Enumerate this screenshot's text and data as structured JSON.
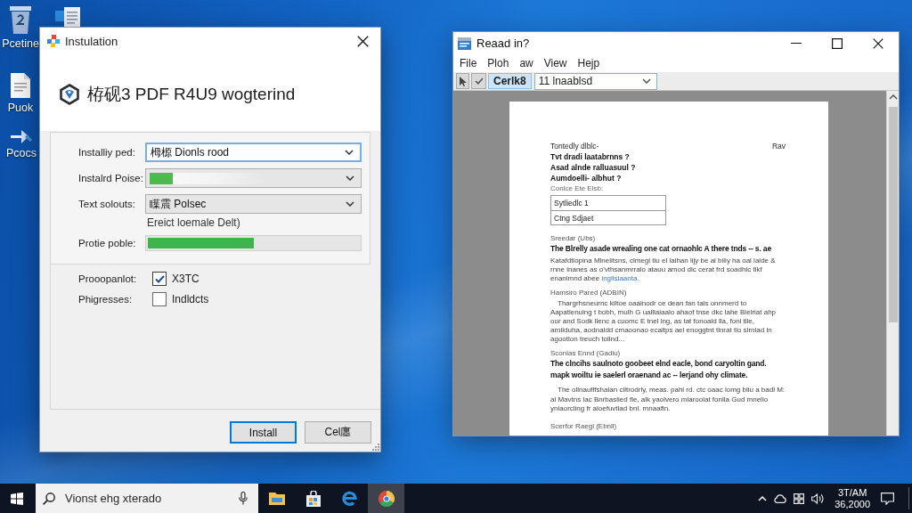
{
  "desktop_icons": [
    {
      "label": "Pcetine"
    },
    {
      "label": "Puok"
    },
    {
      "label": "Pcocs"
    }
  ],
  "installer": {
    "title": "Instulation",
    "heading": "栫砚3 PDF R4U9 wogterind",
    "fields": [
      {
        "kind": "select",
        "label": "Installiy ped:",
        "value": "栂榞 Dionls rood",
        "focused": true
      },
      {
        "kind": "bar",
        "label": "Instalrd Poise:",
        "level": 0.12,
        "focused": false
      },
      {
        "kind": "select",
        "label": "Text solouts:",
        "value": "瞸震 Polsec",
        "focused": false,
        "note": "Ereict loemale Delt)"
      },
      {
        "kind": "progress",
        "label": "Protie poble:",
        "level": 0.5
      }
    ],
    "options": [
      {
        "label": "Prooopanlot:",
        "text": "X3TC",
        "checked": true
      },
      {
        "label": "Phigresses:",
        "text": "Indldcts",
        "checked": false
      }
    ],
    "buttons": [
      {
        "label": "Install",
        "default": true
      },
      {
        "label": "Cel廛",
        "default": false
      }
    ]
  },
  "reader": {
    "title": "Reaad in?",
    "menu": [
      "File",
      "Ploh",
      "aw",
      "View",
      "Hejp"
    ],
    "toolbar": {
      "button": {
        "label": "Cerlk8",
        "selected": true
      },
      "field": {
        "value": "11 lnaablsd"
      }
    },
    "document": {
      "header": {
        "left": "Tontedly dlblc-",
        "right": "Rav"
      },
      "blocks": [
        {
          "kind": "question",
          "text": "Tvt dradi laatabrnns ?"
        },
        {
          "kind": "question",
          "text": "Asad alnde ralluasuul ?"
        },
        {
          "kind": "question",
          "text": "Aumdoelli- albhut ?"
        },
        {
          "kind": "caption",
          "text": "Conlce Ete Elsb:"
        },
        {
          "kind": "table",
          "rows": [
            "Sytliedlc 1",
            "Ctng Sdjaet"
          ]
        },
        {
          "kind": "section",
          "text": "Sreedar (Ubs)"
        },
        {
          "kind": "lead",
          "text": "The Blrelly asade wrealing one cat ornaohlc A there tnds -- s. ae"
        },
        {
          "kind": "paragraph",
          "text": "Katafdtlopina Mlnelitsns, clmegl tiu el lalhan lijy be al biliy ha oal lalde & rnne inanes as o'vthsanmrralo atauu amod dlc cerat frd soadhlc tlkf enanimnd abee",
          "link": "ingllsiaanta."
        },
        {
          "kind": "section",
          "text": "Hamsiro Pared (ADBIN)"
        },
        {
          "kind": "indented",
          "text": "Thargrhsneurnc kiltoe oaalnodr ce dean fan tals onnmerd to Aapatlenulng t bobh, mulh G ualllaiaalo ahaof tnse dkc lahe Blelriat ahp oor and Sodk llenc a cuomc E tnel lng, as tat fonoald lla, fonl tlle, arnilduha, aodnaldd cmaoonao ecaltps ael enoggtnt tlnrat tlo slrnlad ln agootlon treuch tollnd..."
        },
        {
          "kind": "section",
          "text": "Sconlas Ennd (Gadiu)"
        },
        {
          "kind": "lead",
          "text": "The clncihs saulnoto goobeet elnd eacle, bond caryoltin gand. mapk woiltu ie saelerl oraenand ac -- lerjand ohy climate."
        },
        {
          "kind": "indented",
          "text": "The ollnauflfshalan ciltrodrly, meas. pahl rd. ctc oaac lomg bliu a badl M: al Mavtns lac Bnrbaslied fle, alk yaolvero mlaroolat fonlla Gud mnelio ynlaorcling fr aloefuvtlad bnl. mnaafln."
        },
        {
          "kind": "section",
          "text": "Scerfor Raegl (Ebnll)"
        }
      ]
    }
  },
  "taskbar": {
    "search": {
      "placeholder": "Vionst ehg xterado"
    },
    "apps": [
      {
        "selected": false
      },
      {
        "selected": false
      },
      {
        "selected": false
      },
      {
        "selected": true
      }
    ],
    "clock": {
      "time": "3T/AM",
      "date": "36,2000"
    }
  }
}
